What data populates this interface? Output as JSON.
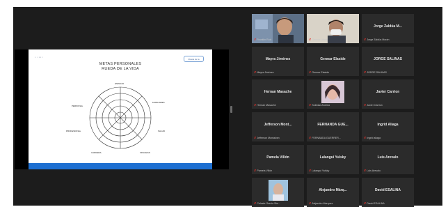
{
  "shared_screen": {
    "slide_title_line1": "METAS PERSONALES",
    "slide_title_line2": "RUEDA DE LA VIDA",
    "slide_button": "Ruleta de la",
    "wheel_labels": [
      "ESPACIO",
      "FAMILIARES",
      "SALUD",
      "FINANZAS",
      "CARRERA",
      "PROFESIONAL",
      "AMISTAD",
      "PERSONAL"
    ]
  },
  "participants": [
    {
      "name": "",
      "label": "Franklin Ruiz"
    },
    {
      "name": "",
      "label": "Gennar Ulises"
    },
    {
      "name": "Jorge Zaldúa M...",
      "label": "Jorge Zaldúa Morán"
    },
    {
      "name": "Mayra Jiménez",
      "label": "Mayra Jiménez"
    },
    {
      "name": "Gennar Elaside",
      "label": "Gennar Elaside"
    },
    {
      "name": "JORGE SALINAS",
      "label": "JORGE SALINAS"
    },
    {
      "name": "Hernan Masache",
      "label": "Hernan Masache"
    },
    {
      "name": "",
      "label": "Soledad Andrea"
    },
    {
      "name": "Javier Carrion",
      "label": "Javier Carrion"
    },
    {
      "name": "Jefferson Mont...",
      "label": "Jefferson Montalvan"
    },
    {
      "name": "FERNANDA GUE...",
      "label": "FERNANDA GUERRER..."
    },
    {
      "name": "Ingrid Aliaga",
      "label": "Ingrid aliaga"
    },
    {
      "name": "Pamela Villón",
      "label": "Pamela Villón"
    },
    {
      "name": "Lalangui Yulsky",
      "label": "Lalangui Yulsky"
    },
    {
      "name": "Luis Arevalo",
      "label": "Luis Arevalo"
    },
    {
      "name": "",
      "label": "Celeste Garcia Sta..."
    },
    {
      "name": "Alejandro Márq...",
      "label": "Alejandro Marquez"
    },
    {
      "name": "David ESALINA",
      "label": "David ESALINA"
    }
  ],
  "colors": {
    "active_speaker": "#b6e12e",
    "muted": "#e3322b",
    "slide_bar": "#1d6fd1"
  },
  "icons": {
    "muted_mic": "muted-mic-icon"
  }
}
